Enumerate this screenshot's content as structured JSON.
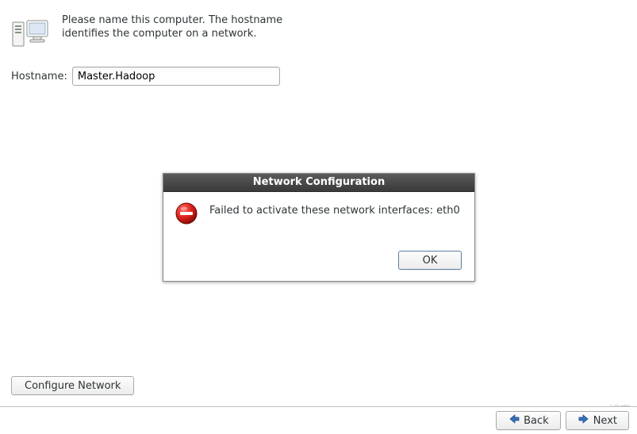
{
  "header": {
    "instruction": "Please name this computer.  The hostname identifies the computer on a network."
  },
  "hostname": {
    "label": "Hostname:",
    "value": "Master.Hadoop"
  },
  "buttons": {
    "configure_network": "Configure Network",
    "back": "Back",
    "next": "Next"
  },
  "dialog": {
    "title": "Network Configuration",
    "message": "Failed to activate these network interfaces: eth0",
    "ok": "OK"
  },
  "watermark": "@51CTO博客"
}
